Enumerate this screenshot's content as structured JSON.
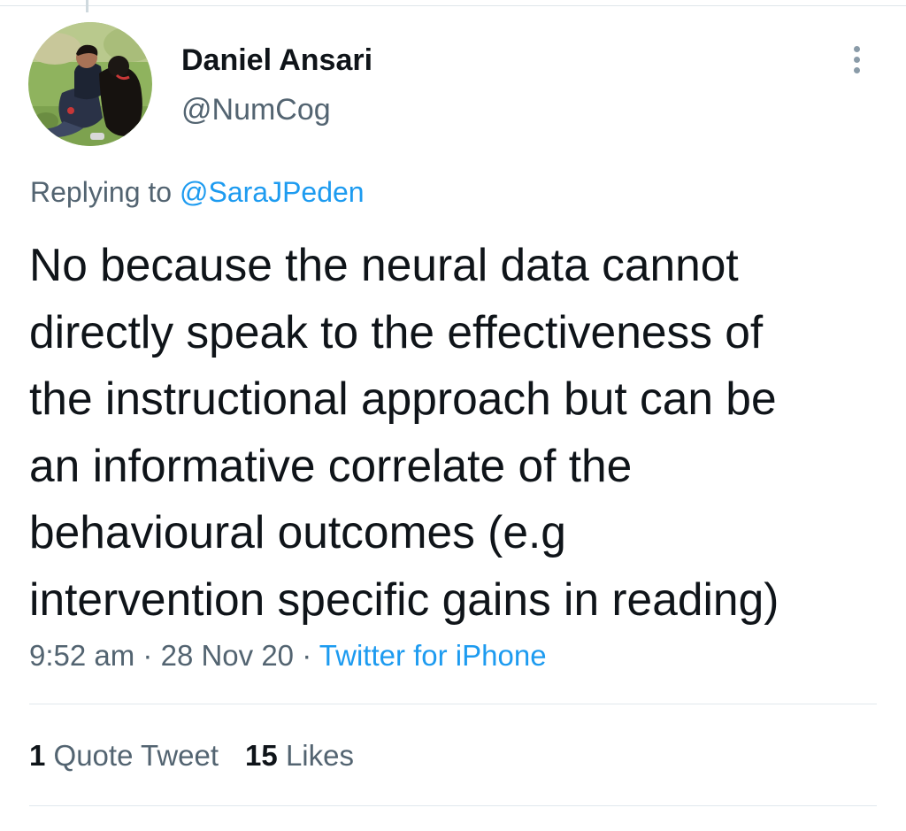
{
  "tweet": {
    "author": {
      "display_name": "Daniel Ansari",
      "handle": "@NumCog",
      "avatar_icon": "profile-photo"
    },
    "reply": {
      "prefix": "Replying to",
      "handle": "@SaraJPeden"
    },
    "text_lines": [
      "No because the neural data cannot",
      "directly speak to the effectiveness of",
      "the instructional approach but can be",
      "an informative correlate of the",
      "behavioural outcomes (e.g",
      "intervention specific gains in reading)"
    ],
    "meta": {
      "time": "9:52 am",
      "separator": "·",
      "date": "28 Nov 20",
      "source": "Twitter for iPhone"
    },
    "stats": {
      "quote_count": "1",
      "quote_label": "Quote Tweet",
      "like_count": "15",
      "like_label": "Likes"
    },
    "more_icon": "more-vertical-icon"
  },
  "colors": {
    "text": "#0f1419",
    "secondary": "#536471",
    "link": "#1d9bf0",
    "divider": "#e1e8ed"
  }
}
